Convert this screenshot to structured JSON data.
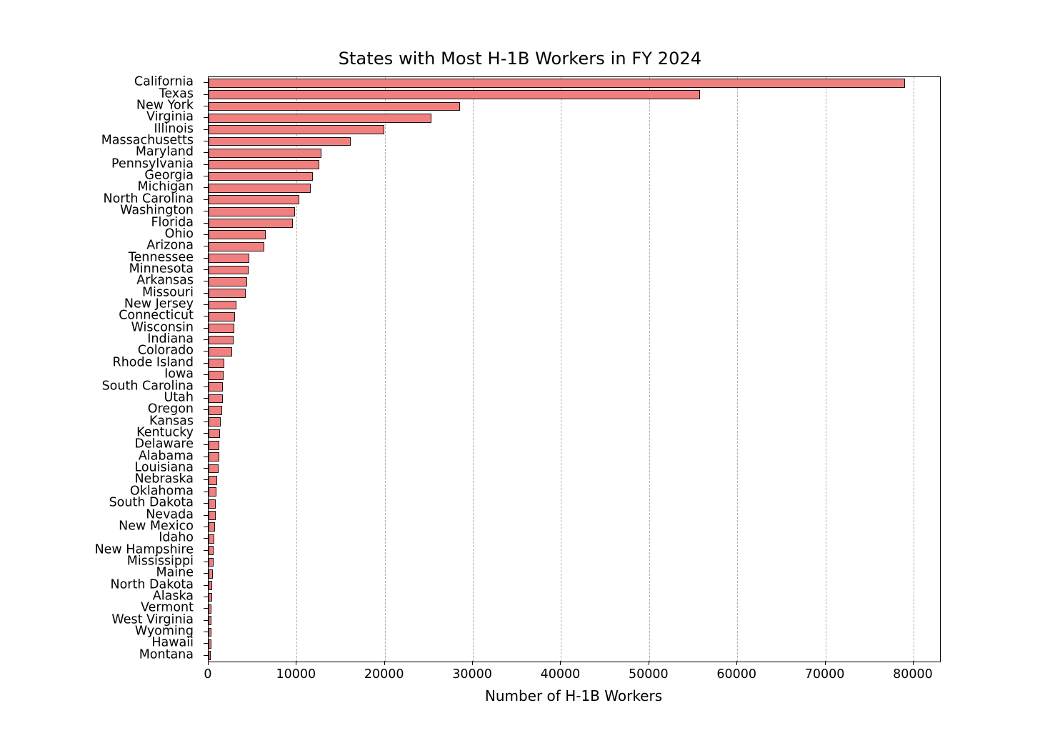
{
  "chart_data": {
    "type": "bar",
    "orientation": "horizontal",
    "title": "States with Most H-1B Workers in FY 2024",
    "xlabel": "Number of H-1B Workers",
    "ylabel": "",
    "xlim": [
      0,
      83000
    ],
    "ylim": [
      0,
      50
    ],
    "grid": "vertical dashed gray on x-axis only",
    "legend": "none",
    "bar_color": "#f08080",
    "bar_edge_color": "#1a1010",
    "xticks": [
      0,
      10000,
      20000,
      30000,
      40000,
      50000,
      60000,
      70000,
      80000
    ],
    "xtick_labels": [
      "0",
      "10000",
      "20000",
      "30000",
      "40000",
      "50000",
      "60000",
      "70000",
      "80000"
    ],
    "categories": [
      "California",
      "Texas",
      "New York",
      "Virginia",
      "Illinois",
      "Massachusetts",
      "Maryland",
      "Pennsylvania",
      "Georgia",
      "Michigan",
      "North Carolina",
      "Washington",
      "Florida",
      "Ohio",
      "Arizona",
      "Tennessee",
      "Minnesota",
      "Arkansas",
      "Missouri",
      "New Jersey",
      "Connecticut",
      "Wisconsin",
      "Indiana",
      "Colorado",
      "Rhode Island",
      "Iowa",
      "South Carolina",
      "Utah",
      "Oregon",
      "Kansas",
      "Kentucky",
      "Delaware",
      "Alabama",
      "Louisiana",
      "Nebraska",
      "Oklahoma",
      "South Dakota",
      "Nevada",
      "New Mexico",
      "Idaho",
      "New Hampshire",
      "Mississippi",
      "Maine",
      "North Dakota",
      "Alaska",
      "Vermont",
      "West Virginia",
      "Wyoming",
      "Hawaii",
      "Montana"
    ],
    "values": [
      79000,
      55800,
      28500,
      25300,
      19900,
      16100,
      12800,
      12600,
      11800,
      11600,
      10300,
      9800,
      9600,
      6500,
      6300,
      4650,
      4550,
      4350,
      4250,
      3200,
      3000,
      2900,
      2850,
      2700,
      1750,
      1700,
      1650,
      1600,
      1550,
      1350,
      1300,
      1250,
      1200,
      1100,
      1000,
      900,
      850,
      800,
      750,
      650,
      600,
      550,
      450,
      400,
      380,
      350,
      330,
      320,
      300,
      280
    ]
  }
}
